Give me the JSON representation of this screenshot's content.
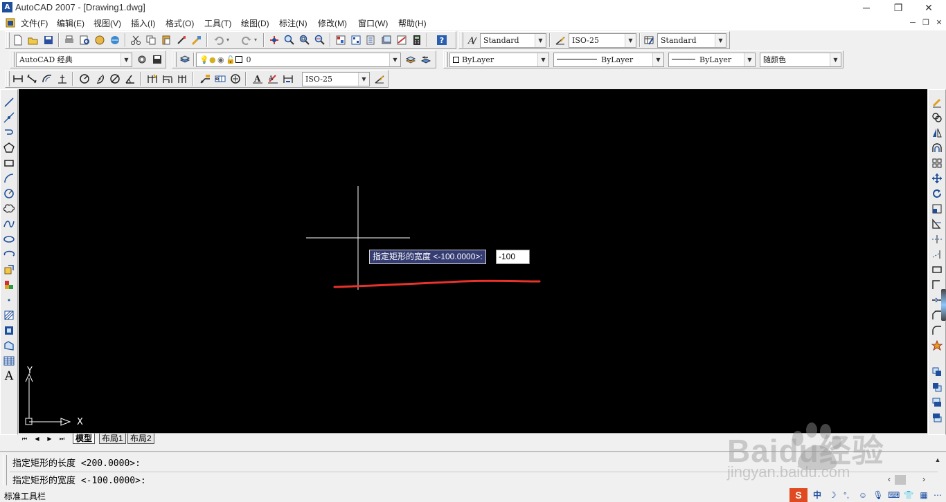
{
  "window": {
    "title": "AutoCAD 2007 - [Drawing1.dwg]",
    "logo_text": "A",
    "min_glyph": "─",
    "max_glyph": "❐",
    "close_glyph": "✕"
  },
  "menu": {
    "items": [
      "文件(F)",
      "编辑(E)",
      "视图(V)",
      "插入(I)",
      "格式(O)",
      "工具(T)",
      "绘图(D)",
      "标注(N)",
      "修改(M)",
      "窗口(W)",
      "帮助(H)"
    ],
    "doc_min": "─",
    "doc_restore": "❐",
    "doc_close": "✕"
  },
  "styles_toolbar": {
    "text_style": "Standard",
    "dim_style": "ISO-25",
    "table_style": "Standard"
  },
  "workspace_toolbar": {
    "workspace": "AutoCAD 经典"
  },
  "layers_toolbar": {
    "layer": "0"
  },
  "properties_toolbar": {
    "color": "ByLayer",
    "linetype": "ByLayer",
    "lineweight": "ByLayer",
    "plot_style": "随颜色"
  },
  "dimension_toolbar": {
    "dim_style": "ISO-25"
  },
  "drawing": {
    "prompt_label": "指定矩形的宽度 <-100.0000>:",
    "prompt_value": "-100",
    "ucs_x": "X",
    "ucs_y": "Y",
    "annotation_color": "#e8322a",
    "background_color": "#000000"
  },
  "layout_tabs": {
    "nav_first": "⏮",
    "nav_prev": "◀",
    "nav_next": "▶",
    "nav_last": "⏭",
    "tabs": [
      "模型",
      "布局1",
      "布局2"
    ]
  },
  "command": {
    "lines": [
      "指定矩形的长度 <200.0000>:",
      "指定矩形的宽度 <-100.0000>:"
    ]
  },
  "status": {
    "text": "标准工具栏"
  },
  "watermark": {
    "text": "Baidu经验",
    "url": "jingyan.baidu.com"
  }
}
